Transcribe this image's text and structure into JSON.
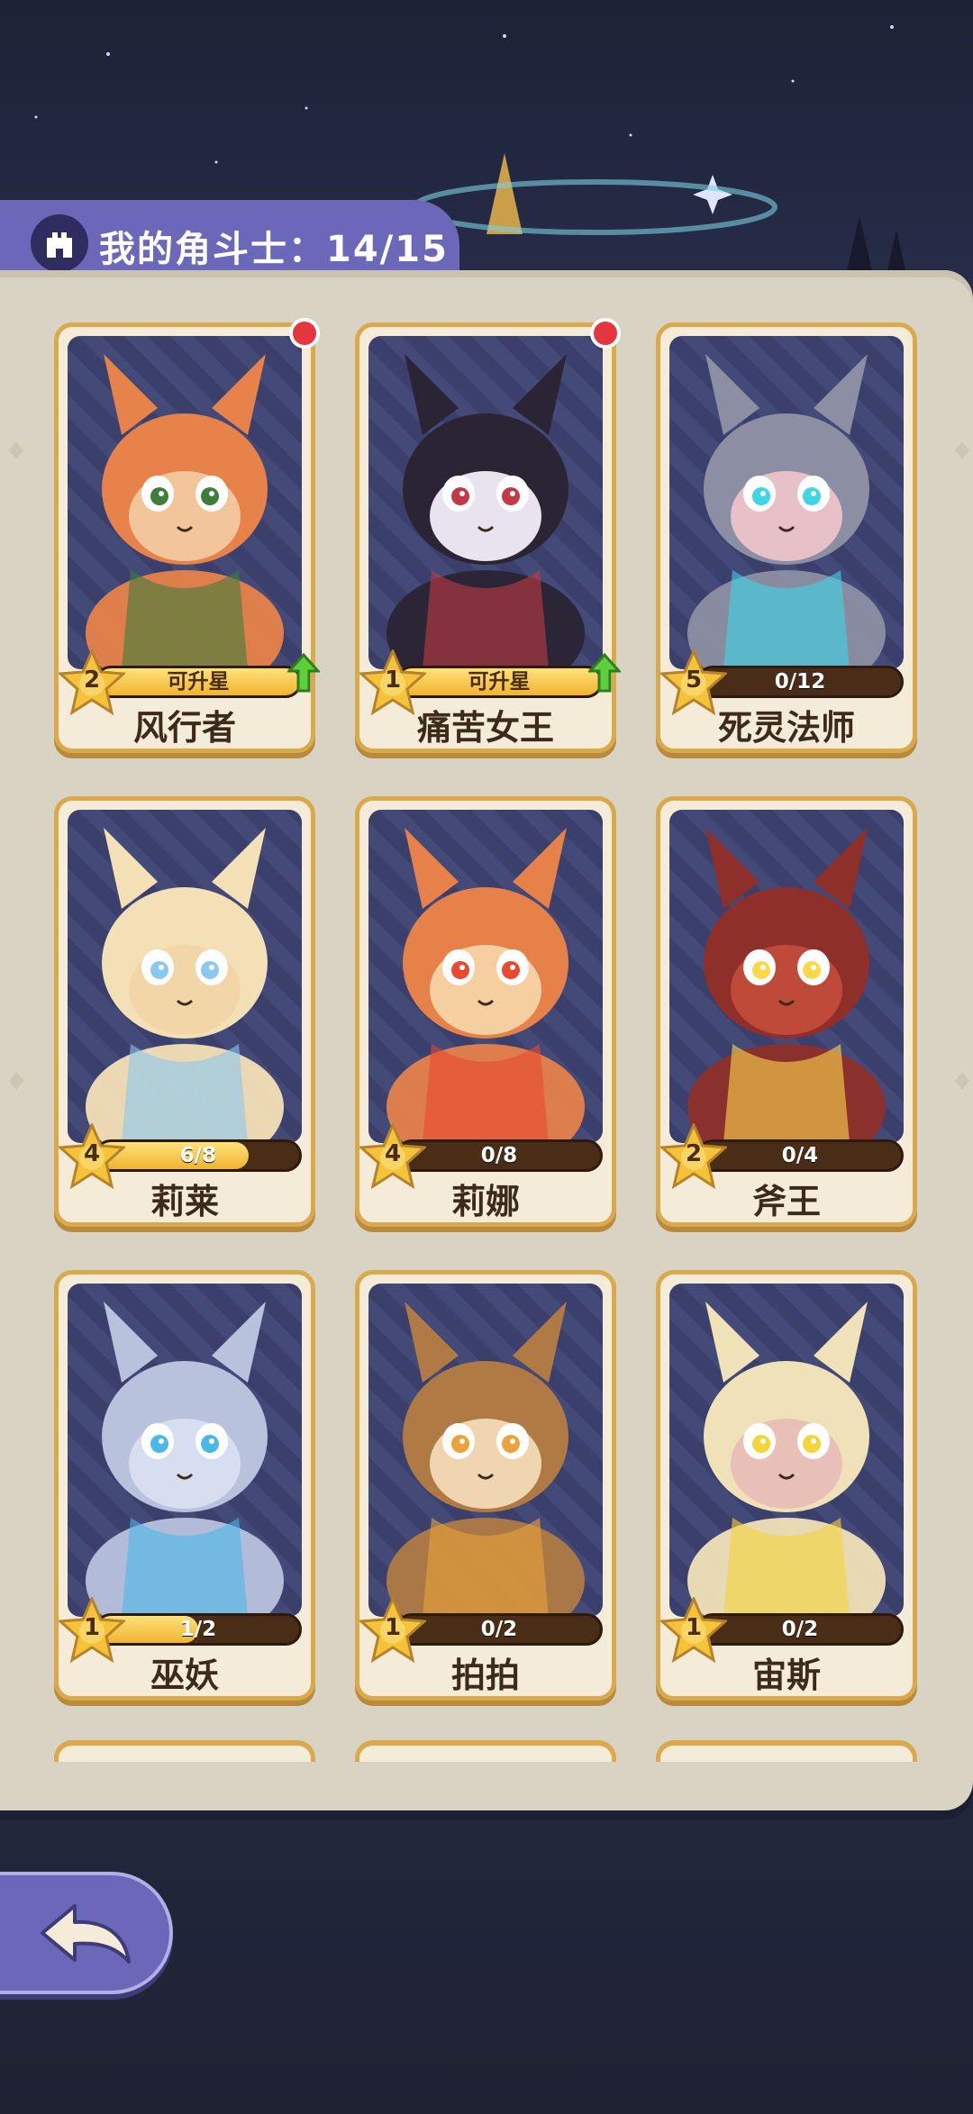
{
  "header": {
    "title": "我的角斗士：14/15",
    "icon": "castle-icon"
  },
  "cards": [
    {
      "name": "风行者",
      "stars": "2",
      "progress_text": "可升星",
      "progress": 1.0,
      "upgradable": true,
      "new": true,
      "colors": {
        "main": "#e7824a",
        "accent": "#3f7d3b",
        "skin": "#f2c59a"
      }
    },
    {
      "name": "痛苦女王",
      "stars": "1",
      "progress_text": "可升星",
      "progress": 1.0,
      "upgradable": true,
      "new": true,
      "colors": {
        "main": "#2a2434",
        "accent": "#c23a45",
        "skin": "#e9e3ef"
      }
    },
    {
      "name": "死灵法师",
      "stars": "5",
      "progress_text": "0/12",
      "progress": 0.0,
      "upgradable": false,
      "new": false,
      "colors": {
        "main": "#8c8fa3",
        "accent": "#3dd6e6",
        "skin": "#e8c0c8"
      }
    },
    {
      "name": "莉莱",
      "stars": "4",
      "progress_text": "6/8",
      "progress": 0.75,
      "upgradable": false,
      "new": false,
      "colors": {
        "main": "#f4e0b6",
        "accent": "#8ac8f0",
        "skin": "#f3d6a8"
      }
    },
    {
      "name": "莉娜",
      "stars": "4",
      "progress_text": "0/8",
      "progress": 0.0,
      "upgradable": false,
      "new": false,
      "colors": {
        "main": "#e6814a",
        "accent": "#e9492e",
        "skin": "#f5cf9f"
      }
    },
    {
      "name": "斧王",
      "stars": "2",
      "progress_text": "0/4",
      "progress": 0.0,
      "upgradable": false,
      "new": false,
      "colors": {
        "main": "#8e2f2a",
        "accent": "#ffd84a",
        "skin": "#c04a3a"
      }
    },
    {
      "name": "巫妖",
      "stars": "1",
      "progress_text": "1/2",
      "progress": 0.5,
      "upgradable": false,
      "new": false,
      "colors": {
        "main": "#b8c2dd",
        "accent": "#4ab8e8",
        "skin": "#d6def0"
      }
    },
    {
      "name": "拍拍",
      "stars": "1",
      "progress_text": "0/2",
      "progress": 0.0,
      "upgradable": false,
      "new": false,
      "colors": {
        "main": "#b07a44",
        "accent": "#e9a33a",
        "skin": "#f0d6b0"
      }
    },
    {
      "name": "宙斯",
      "stars": "1",
      "progress_text": "0/2",
      "progress": 0.0,
      "upgradable": false,
      "new": false,
      "colors": {
        "main": "#f0e2b8",
        "accent": "#f5d43a",
        "skin": "#e8c0b8"
      }
    }
  ],
  "back_button": {
    "icon": "back-arrow-icon"
  }
}
